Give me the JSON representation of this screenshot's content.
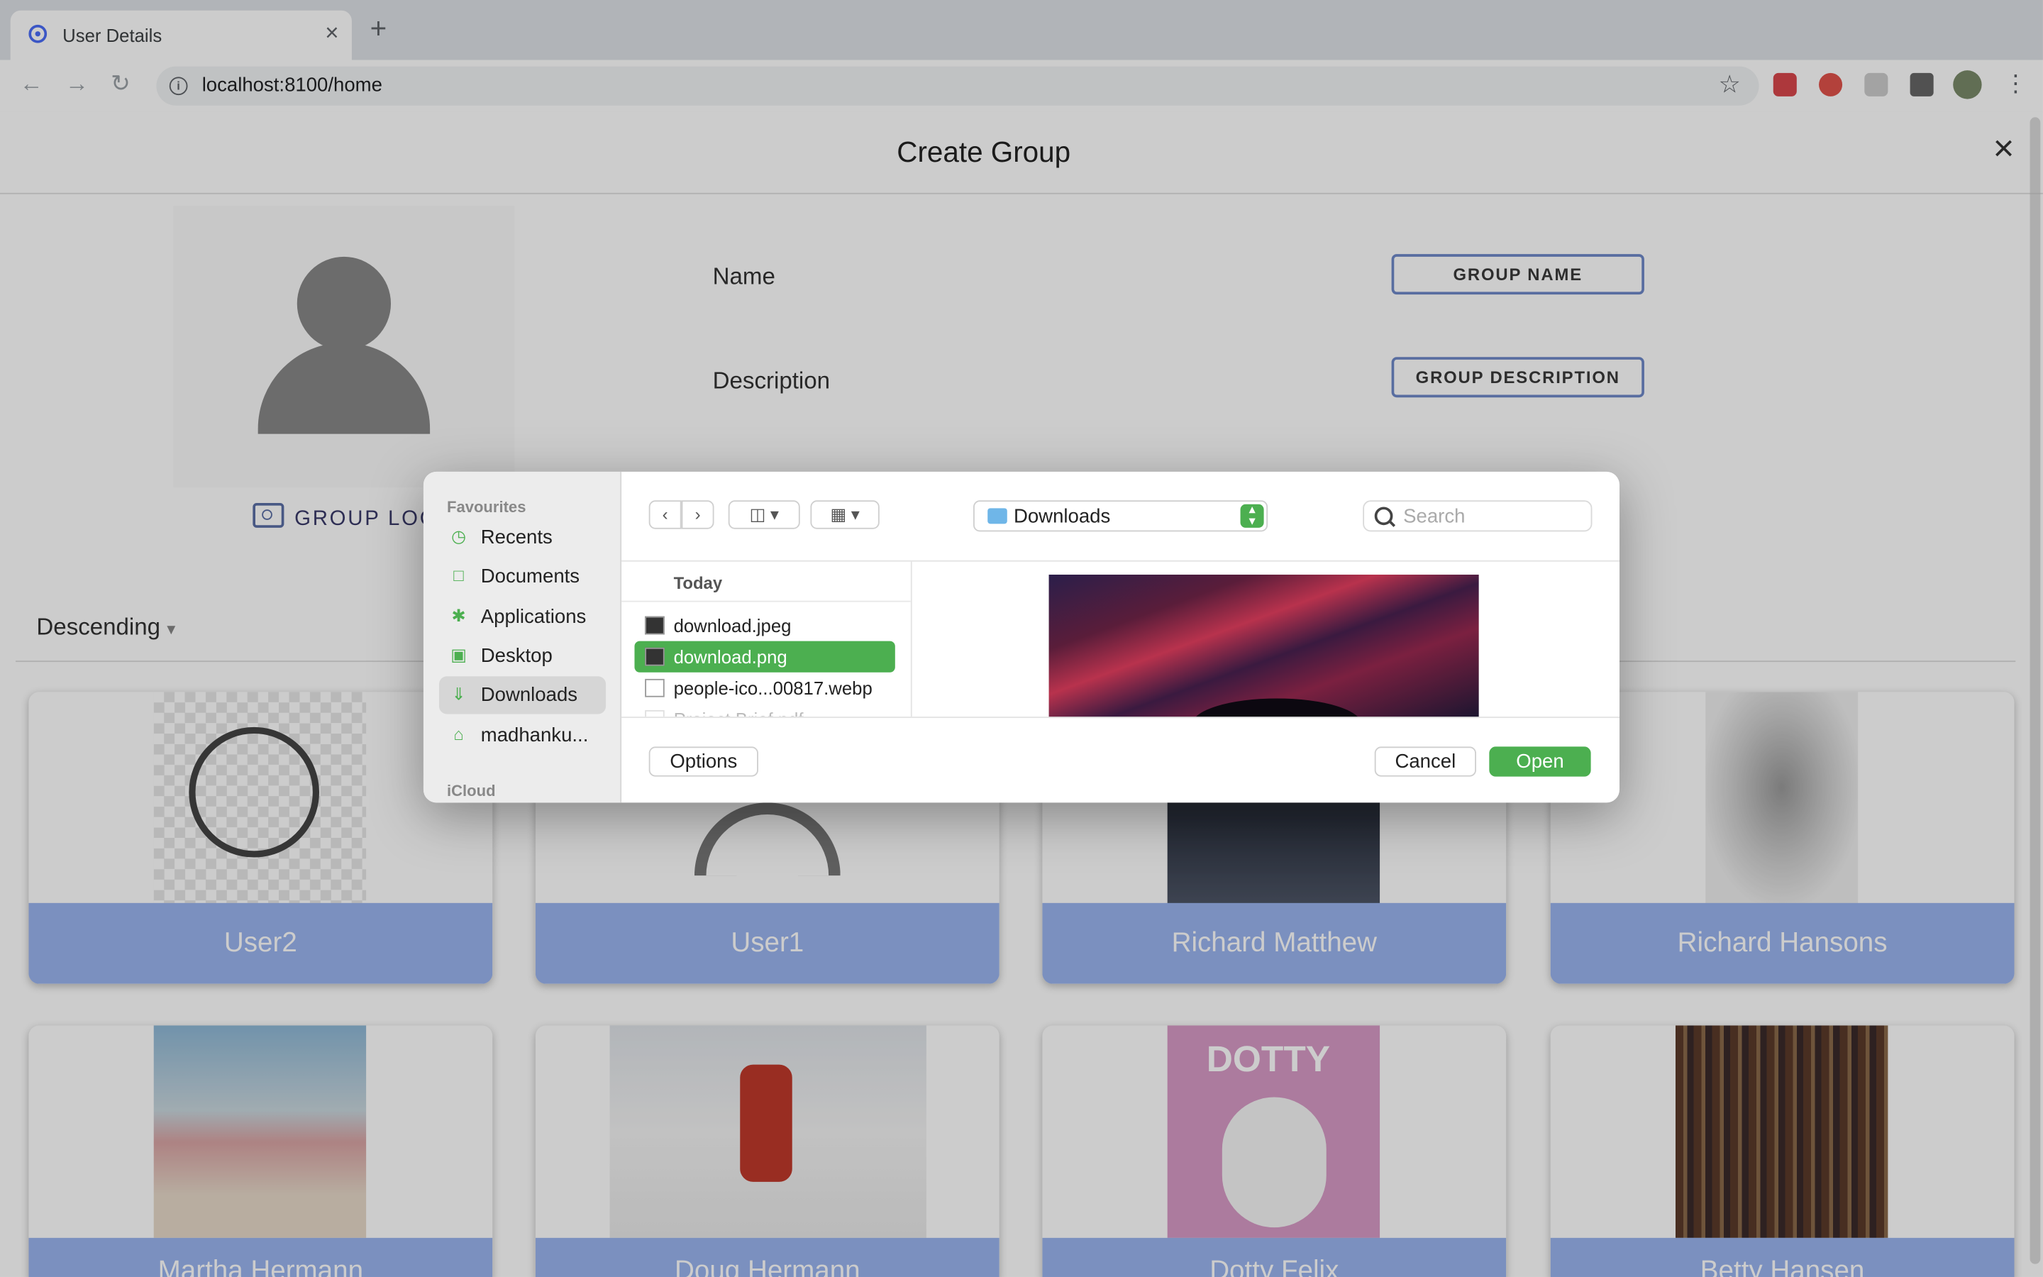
{
  "browser": {
    "tab_title": "User Details",
    "tab_close": "×",
    "new_tab": "+",
    "url": "localhost:8100/home"
  },
  "page": {
    "title": "Create Group",
    "close": "×",
    "group_logo_label": "GROUP LOGO",
    "name_label": "Name",
    "name_button": "GROUP NAME",
    "description_label": "Description",
    "description_button": "GROUP DESCRIPTION",
    "sort_label": "Descending",
    "sort_arrow": "▾",
    "users_row1": [
      "User2",
      "User1",
      "Richard Matthew",
      "Richard Hansons"
    ],
    "users_row2": [
      "Martha Hermann",
      "Doug Hermann",
      "Dotty Felix",
      "Betty Hansen"
    ]
  },
  "dialog": {
    "favourites_heading": "Favourites",
    "icloud_heading": "iCloud",
    "sidebar_items": [
      "Recents",
      "Documents",
      "Applications",
      "Desktop",
      "Downloads",
      "madhanku..."
    ],
    "selected_sidebar": "Downloads",
    "location": "Downloads",
    "search_placeholder": "Search",
    "list_heading": "Today",
    "files": [
      "download.jpeg",
      "download.png",
      "people-ico...00817.webp",
      "Project Brief.pdf"
    ],
    "selected_file": "download.png",
    "options_button": "Options",
    "cancel_button": "Cancel",
    "open_button": "Open"
  },
  "colors": {
    "accent_green": "#4caf50",
    "card_label_blue": "#9ab4ef",
    "field_border": "#6f89c9"
  }
}
